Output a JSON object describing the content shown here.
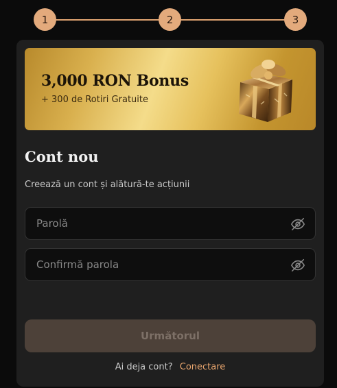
{
  "stepper": {
    "steps": [
      "1",
      "2",
      "3"
    ],
    "accent": "#e3aa7c"
  },
  "banner": {
    "title": "3,000 RON Bonus",
    "subtitle": "+ 300 de Rotiri Gratuite",
    "image": "gift-box-icon"
  },
  "form": {
    "title": "Cont nou",
    "subtitle": "Creează un cont și alătură-te acțiunii",
    "password_placeholder": "Parolă",
    "password_value": "",
    "confirm_placeholder": "Confirmă parola",
    "confirm_value": "",
    "toggle_icon": "eye-off-icon"
  },
  "actions": {
    "next_label": "Următorul"
  },
  "footer": {
    "question": "Ai deja cont?",
    "login_link": "Conectare",
    "link_color": "#e8a56e"
  }
}
